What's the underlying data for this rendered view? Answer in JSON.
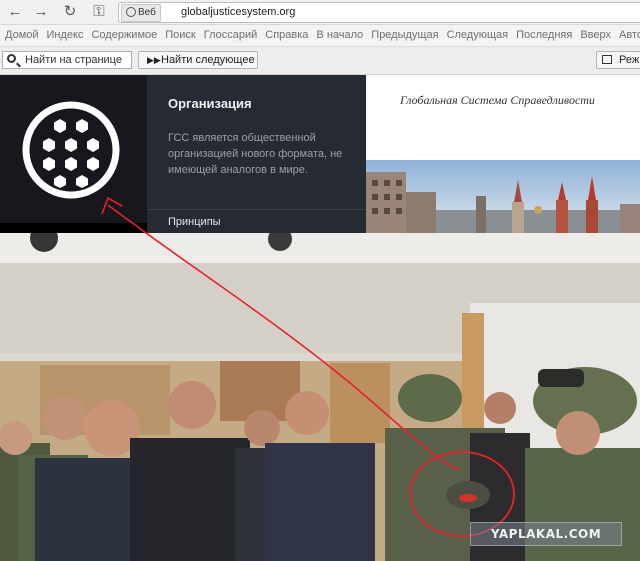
{
  "browser": {
    "nav": {
      "back_icon": "←",
      "forward_icon": "→",
      "reload_icon": "↻",
      "key_icon": "⚿"
    },
    "url_badge": "Веб",
    "url": "globaljusticesystem.org",
    "menu": [
      "Домой",
      "Индекс",
      "Содержимое",
      "Поиск",
      "Глоссарий",
      "Справка",
      "В начало",
      "Предыдущая",
      "Следующая",
      "Последняя",
      "Вверх",
      "Автор"
    ],
    "find": {
      "placeholder": "Найти на странице",
      "next_label": "Найти следующее",
      "right_label": "Режи"
    }
  },
  "site": {
    "org_title": "Организация",
    "org_description": "ГСС является общественной организацией нового формата, не имеющей аналогов в мире.",
    "org_link": "Принципы",
    "tagline": "Глобальная Система Справедливости"
  },
  "watermark": "YAPLAKAL.COM",
  "colors": {
    "logo_panel": "#16181d",
    "org_panel": "#262a33",
    "annotation_red": "#e8212a"
  }
}
